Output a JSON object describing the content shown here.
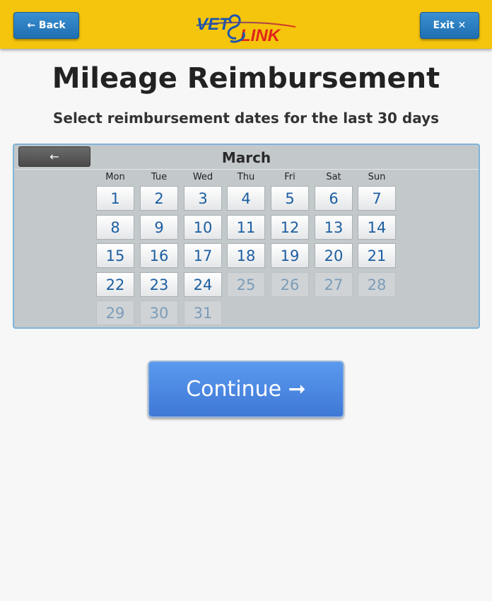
{
  "header": {
    "back_label": "← Back",
    "exit_label": "Exit ✕",
    "logo_text_left": "VET",
    "logo_text_right": "LINK",
    "bg_color": "#f5c40c"
  },
  "page": {
    "title": "Mileage Reimbursement",
    "subtitle": "Select reimbursement dates for the last 30 days"
  },
  "calendar": {
    "prev_label": "←",
    "month": "March",
    "weekdays": [
      "Mon",
      "Tue",
      "Wed",
      "Thu",
      "Fri",
      "Sat",
      "Sun"
    ],
    "days": [
      {
        "label": "1",
        "enabled": true
      },
      {
        "label": "2",
        "enabled": true
      },
      {
        "label": "3",
        "enabled": true
      },
      {
        "label": "4",
        "enabled": true
      },
      {
        "label": "5",
        "enabled": true
      },
      {
        "label": "6",
        "enabled": true
      },
      {
        "label": "7",
        "enabled": true
      },
      {
        "label": "8",
        "enabled": true
      },
      {
        "label": "9",
        "enabled": true
      },
      {
        "label": "10",
        "enabled": true
      },
      {
        "label": "11",
        "enabled": true
      },
      {
        "label": "12",
        "enabled": true
      },
      {
        "label": "13",
        "enabled": true
      },
      {
        "label": "14",
        "enabled": true
      },
      {
        "label": "15",
        "enabled": true
      },
      {
        "label": "16",
        "enabled": true
      },
      {
        "label": "17",
        "enabled": true
      },
      {
        "label": "18",
        "enabled": true
      },
      {
        "label": "19",
        "enabled": true
      },
      {
        "label": "20",
        "enabled": true
      },
      {
        "label": "21",
        "enabled": true
      },
      {
        "label": "22",
        "enabled": true
      },
      {
        "label": "23",
        "enabled": true
      },
      {
        "label": "24",
        "enabled": true
      },
      {
        "label": "25",
        "enabled": false
      },
      {
        "label": "26",
        "enabled": false
      },
      {
        "label": "27",
        "enabled": false
      },
      {
        "label": "28",
        "enabled": false
      },
      {
        "label": "29",
        "enabled": false
      },
      {
        "label": "30",
        "enabled": false
      },
      {
        "label": "31",
        "enabled": false
      }
    ]
  },
  "continue_label": "Continue ➞"
}
